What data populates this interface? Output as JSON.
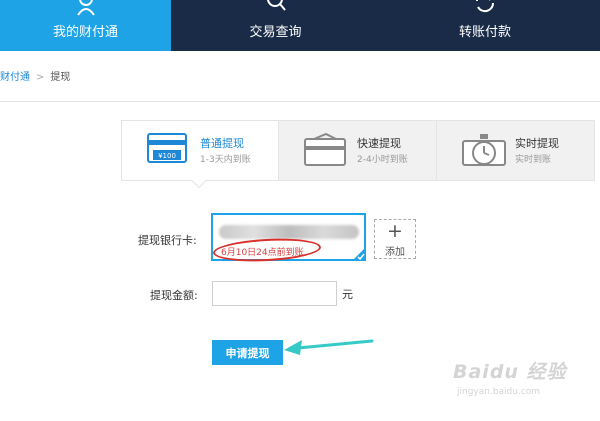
{
  "nav": {
    "items": [
      {
        "label": "我的财付通",
        "icon": "user-icon",
        "active": true
      },
      {
        "label": "交易查询",
        "icon": "search-icon",
        "active": false
      },
      {
        "label": "转账付款",
        "icon": "transfer-icon",
        "active": false
      }
    ],
    "active_color": "#1ea3e6",
    "bar_color": "#1a2b47"
  },
  "breadcrumb": {
    "parent": "财付通",
    "current": "提现"
  },
  "methods": [
    {
      "title": "普通提现",
      "sub": "1-3天内到账",
      "icon": "card-100-icon",
      "selected": true
    },
    {
      "title": "快速提现",
      "sub": "2-4小时到账",
      "icon": "card-fast-icon",
      "selected": false
    },
    {
      "title": "实时提现",
      "sub": "实时到账",
      "icon": "stopwatch-icon",
      "selected": false
    }
  ],
  "form": {
    "card_label": "提现银行卡:",
    "card_note": "6月10日24点前到账",
    "add_plus": "+",
    "add_label": "添加",
    "amount_label": "提现金额:",
    "amount_value": "",
    "unit": "元",
    "submit_label": "申请提现"
  },
  "watermark": {
    "main": "Baidu 经验",
    "sub": "jingyan.baidu.com"
  },
  "icon_bill_text": "¥100"
}
